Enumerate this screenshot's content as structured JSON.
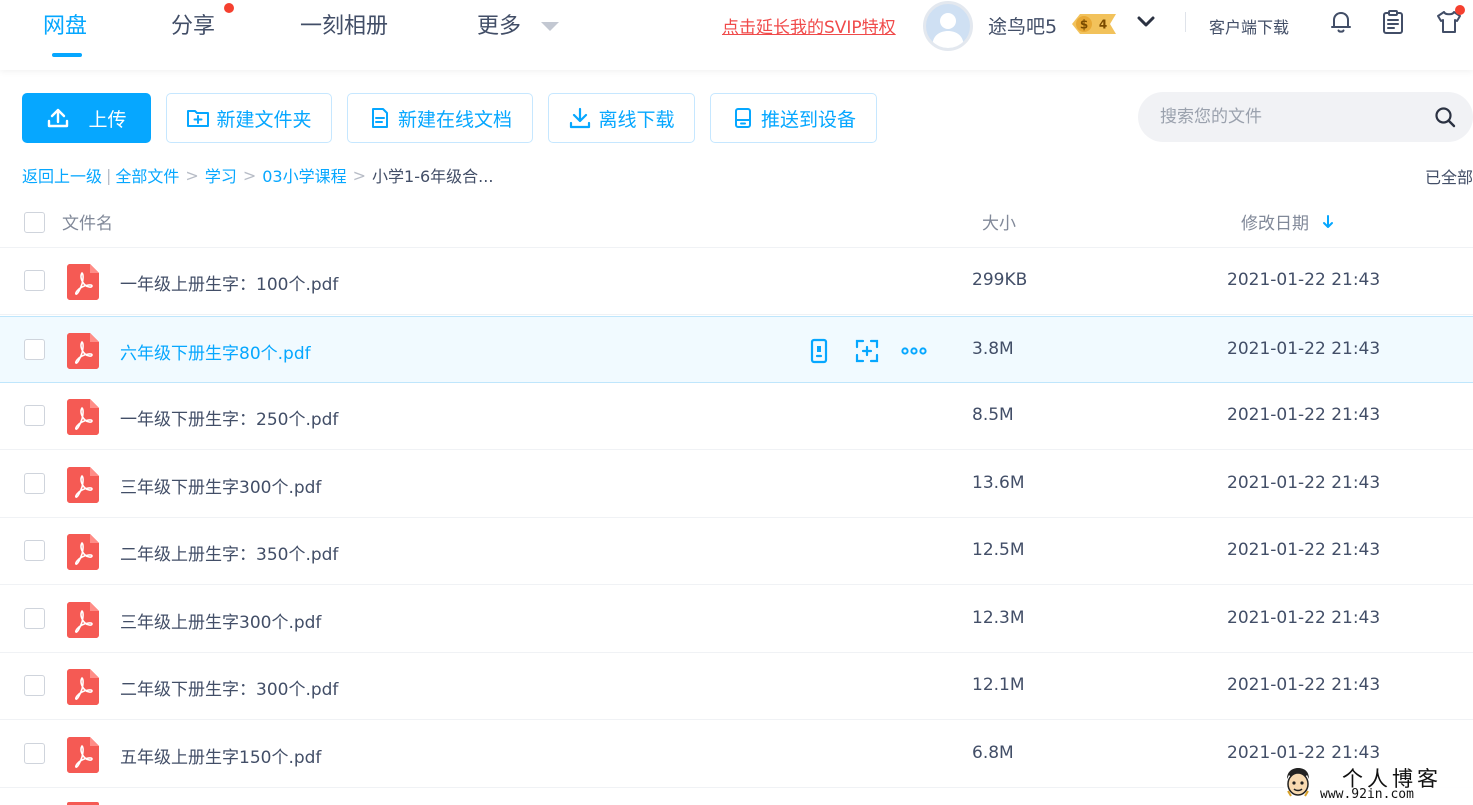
{
  "topnav": {
    "tabs": [
      "网盘",
      "分享",
      "一刻相册",
      "更多"
    ],
    "svip_link": "点击延长我的SVIP特权",
    "username": "途鸟吧5",
    "vip_level": "4",
    "vip_symbol": "$",
    "client_download": "客户端下载",
    "icons": [
      "bell-icon",
      "clipboard-icon",
      "tshirt-icon"
    ]
  },
  "toolbar": {
    "upload": "上传",
    "new_folder": "新建文件夹",
    "new_doc": "新建在线文档",
    "offline_download": "离线下载",
    "push_device": "推送到设备"
  },
  "search": {
    "placeholder": "搜索您的文件"
  },
  "breadcrumb": {
    "back": "返回上一级",
    "items": [
      "全部文件",
      "学习",
      "03小学课程"
    ],
    "current": "小学1-6年级合...",
    "loaded_all": "已全部"
  },
  "list": {
    "columns": {
      "name": "文件名",
      "size": "大小",
      "date": "修改日期"
    },
    "rows": [
      {
        "name": "一年级上册生字：100个.pdf",
        "size": "299KB",
        "date": "2021-01-22 21:43"
      },
      {
        "name": "六年级下册生字80个.pdf",
        "size": "3.8M",
        "date": "2021-01-22 21:43"
      },
      {
        "name": "一年级下册生字：250个.pdf",
        "size": "8.5M",
        "date": "2021-01-22 21:43"
      },
      {
        "name": "三年级下册生字300个.pdf",
        "size": "13.6M",
        "date": "2021-01-22 21:43"
      },
      {
        "name": "二年级上册生字：350个.pdf",
        "size": "12.5M",
        "date": "2021-01-22 21:43"
      },
      {
        "name": "三年级上册生字300个.pdf",
        "size": "12.3M",
        "date": "2021-01-22 21:43"
      },
      {
        "name": "二年级下册生字：300个.pdf",
        "size": "12.1M",
        "date": "2021-01-22 21:43"
      },
      {
        "name": "五年级上册生字150个.pdf",
        "size": "6.8M",
        "date": "2021-01-22 21:43"
      }
    ]
  },
  "watermark": {
    "cn": "个人博客",
    "url": "www.92in.com"
  },
  "colors": {
    "accent": "#06a7ff",
    "pdf": "#f55a54",
    "svip": "#f04a4a",
    "text": "#424e67"
  }
}
